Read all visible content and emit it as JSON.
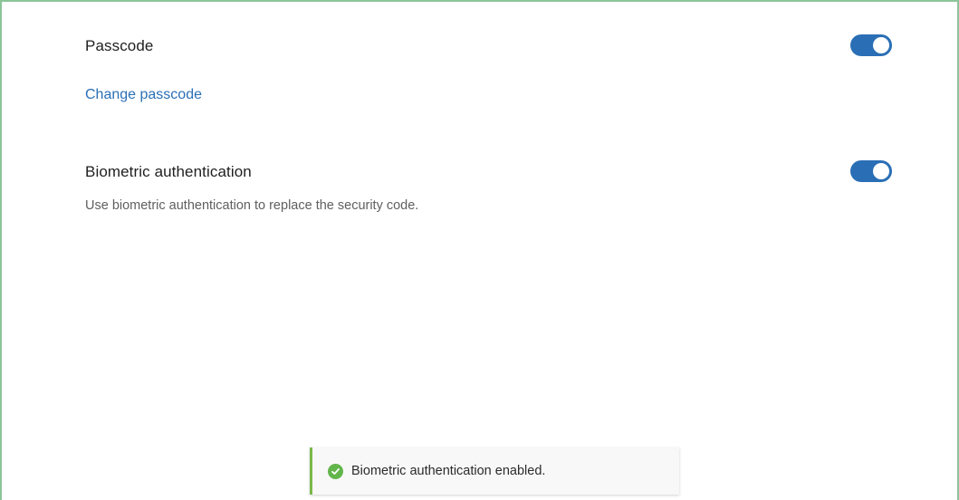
{
  "settings": {
    "passcode": {
      "title": "Passcode",
      "enabled": true,
      "change_link": "Change passcode"
    },
    "biometric": {
      "title": "Biometric authentication",
      "enabled": true,
      "description": "Use biometric authentication to replace the security code."
    }
  },
  "toast": {
    "message": "Biometric authentication enabled.",
    "icon": "check-circle-icon",
    "status_color": "#62b54a"
  },
  "colors": {
    "accent": "#2a6fb5",
    "frame_border": "#8cc49a",
    "toast_accent": "#79b84a"
  }
}
